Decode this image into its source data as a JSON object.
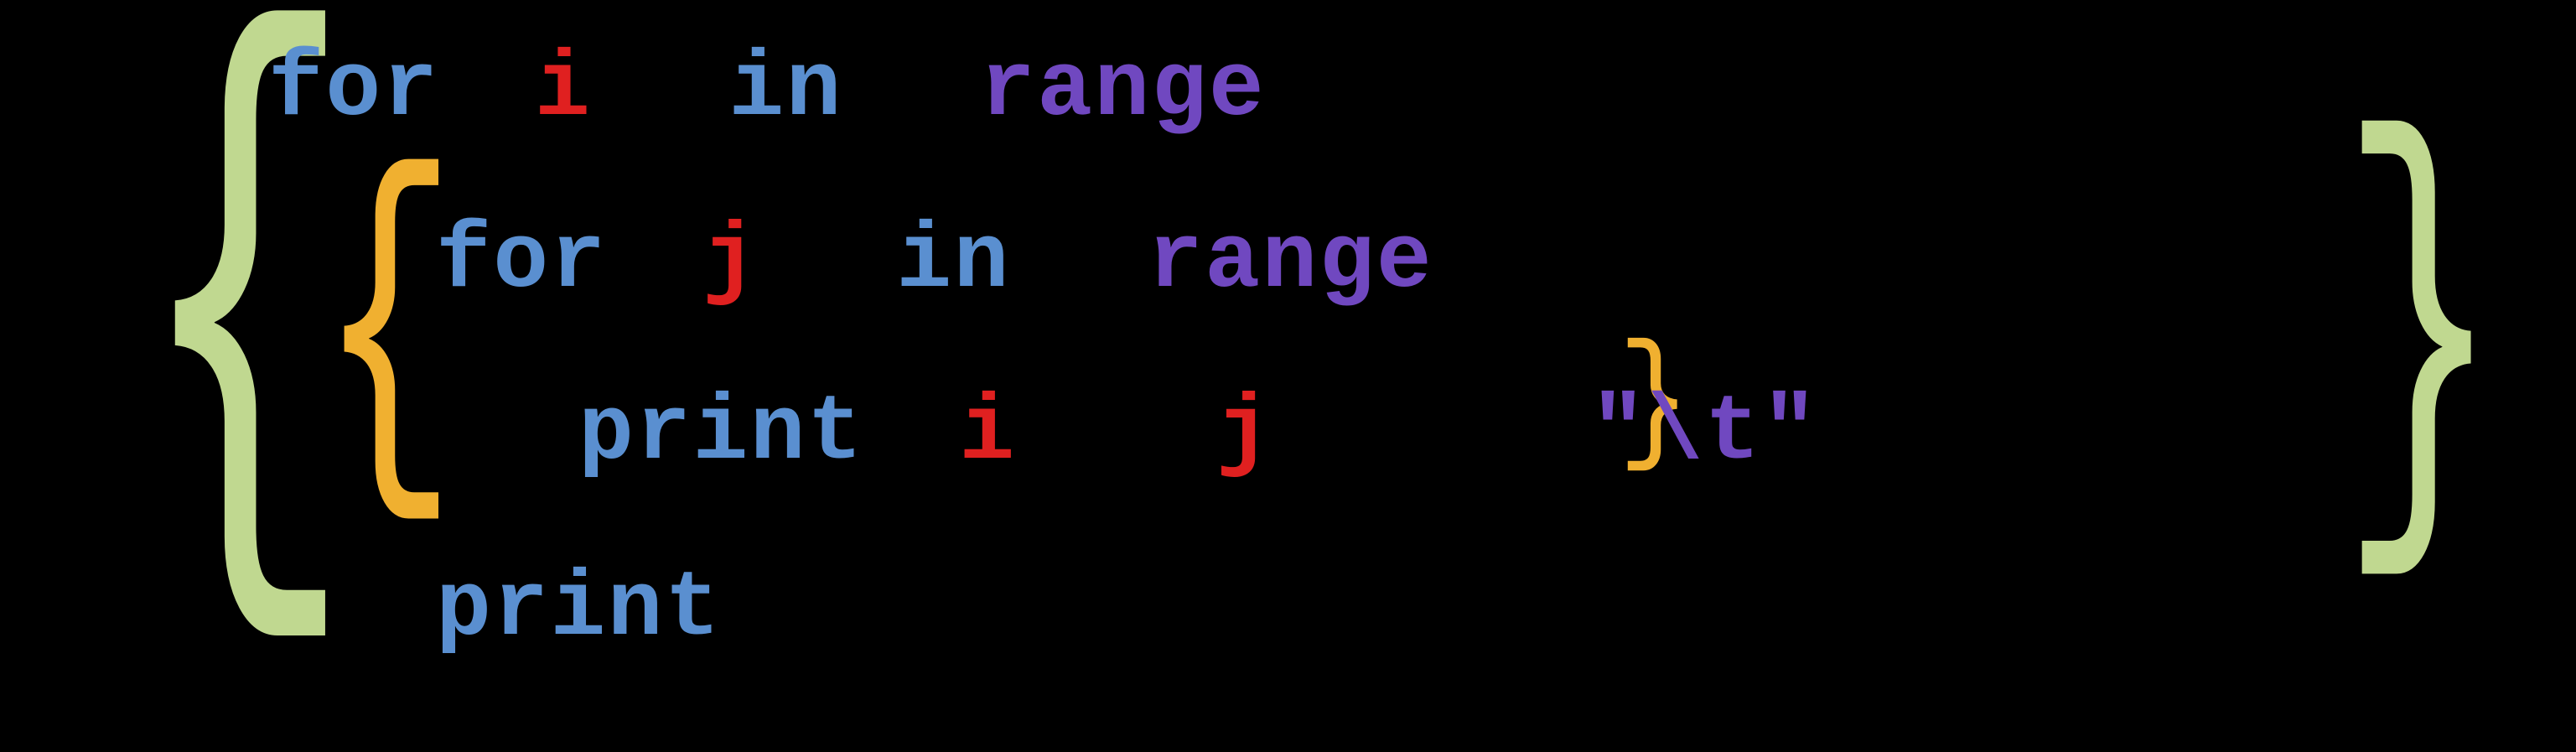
{
  "keywords": {
    "for": "for",
    "in": "in",
    "range": "range",
    "print": "print"
  },
  "variables": {
    "i": "i",
    "j": "j"
  },
  "strings": {
    "tab": "\"\\t\""
  },
  "braces": {
    "open": "{",
    "close": "}"
  },
  "colors": {
    "outer_brace": "#c0d890",
    "inner_brace": "#f0b030",
    "keyword_blue": "#5a8fd0",
    "keyword_purple": "#7048c0",
    "variable_red": "#e02020",
    "string_purple": "#7048c0",
    "background": "#000000"
  }
}
